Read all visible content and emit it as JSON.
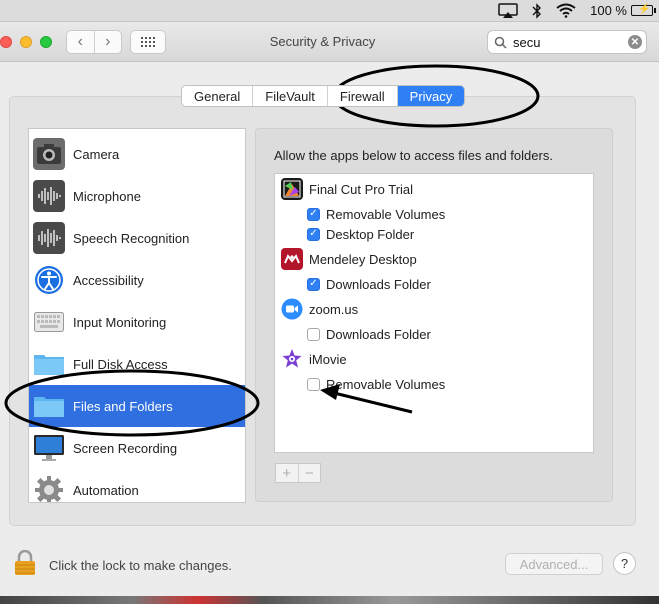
{
  "menubar": {
    "battery_text": "100 %",
    "icons": [
      "airplay-icon",
      "bluetooth-icon",
      "wifi-icon",
      "battery-charging-icon"
    ]
  },
  "window": {
    "title": "Security & Privacy",
    "search_value": "secu",
    "tabs": [
      {
        "label": "General",
        "active": false
      },
      {
        "label": "FileVault",
        "active": false
      },
      {
        "label": "Firewall",
        "active": false
      },
      {
        "label": "Privacy",
        "active": true
      }
    ]
  },
  "sidebar": {
    "items": [
      {
        "label": "Camera",
        "icon": "camera-icon",
        "selected": false
      },
      {
        "label": "Microphone",
        "icon": "microphone-icon",
        "selected": false
      },
      {
        "label": "Speech Recognition",
        "icon": "speech-recognition-icon",
        "selected": false
      },
      {
        "label": "Accessibility",
        "icon": "accessibility-icon",
        "selected": false
      },
      {
        "label": "Input Monitoring",
        "icon": "keyboard-icon",
        "selected": false
      },
      {
        "label": "Full Disk Access",
        "icon": "folder-icon",
        "selected": false
      },
      {
        "label": "Files and Folders",
        "icon": "folder-icon",
        "selected": true
      },
      {
        "label": "Screen Recording",
        "icon": "display-icon",
        "selected": false
      },
      {
        "label": "Automation",
        "icon": "gear-icon",
        "selected": false
      }
    ]
  },
  "main": {
    "description": "Allow the apps below to access files and folders.",
    "apps": [
      {
        "name": "Final Cut Pro Trial",
        "icon": "final-cut-pro-icon",
        "permissions": [
          {
            "label": "Removable Volumes",
            "checked": true
          },
          {
            "label": "Desktop Folder",
            "checked": true
          }
        ]
      },
      {
        "name": "Mendeley Desktop",
        "icon": "mendeley-icon",
        "permissions": [
          {
            "label": "Downloads Folder",
            "checked": true
          }
        ]
      },
      {
        "name": "zoom.us",
        "icon": "zoom-icon",
        "permissions": [
          {
            "label": "Downloads Folder",
            "checked": false
          }
        ]
      },
      {
        "name": "iMovie",
        "icon": "imovie-icon",
        "permissions": [
          {
            "label": "Removable Volumes",
            "checked": false
          }
        ]
      }
    ],
    "add_label": "+",
    "remove_label": "−"
  },
  "footer": {
    "lock_text": "Click the lock to make changes.",
    "advanced_label": "Advanced...",
    "help_label": "?"
  }
}
